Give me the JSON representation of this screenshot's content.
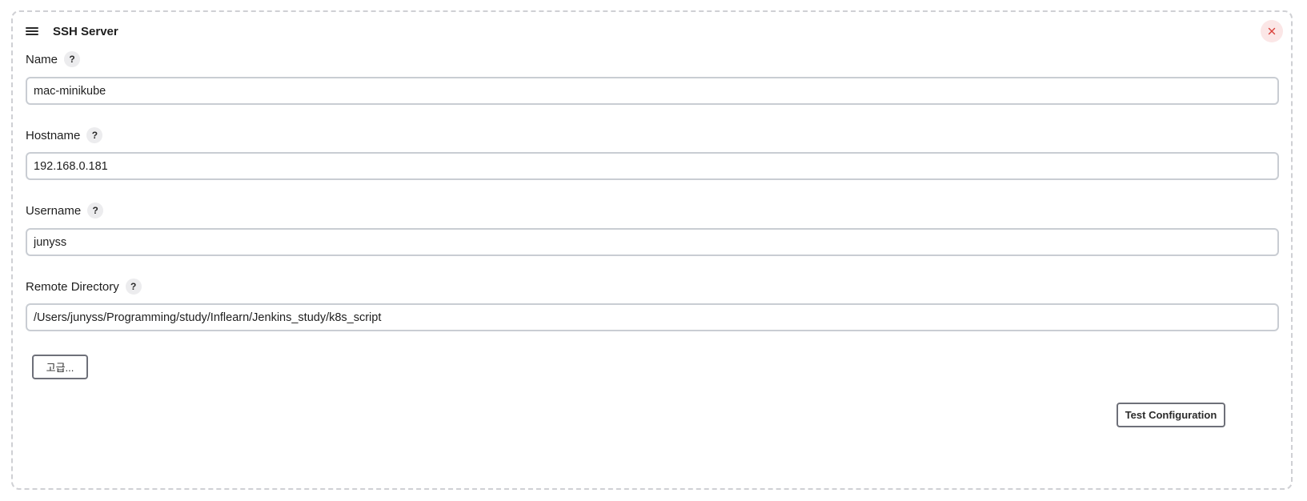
{
  "card": {
    "title": "SSH Server",
    "drag_handle_icon": "hamburger-menu-icon",
    "close_icon": "close-x-icon",
    "close_icon_color": "#d9413b",
    "close_bg_color": "#fbe6e6"
  },
  "fields": {
    "name": {
      "label": "Name",
      "help": "?",
      "value": "mac-minikube"
    },
    "hostname": {
      "label": "Hostname",
      "help": "?",
      "value": "192.168.0.181"
    },
    "username": {
      "label": "Username",
      "help": "?",
      "value": "junyss"
    },
    "remote_directory": {
      "label": "Remote Directory",
      "help": "?",
      "value": "/Users/junyss/Programming/study/Inflearn/Jenkins_study/k8s_script"
    }
  },
  "buttons": {
    "advanced_label": "고급...",
    "test_configuration_label": "Test Configuration"
  }
}
